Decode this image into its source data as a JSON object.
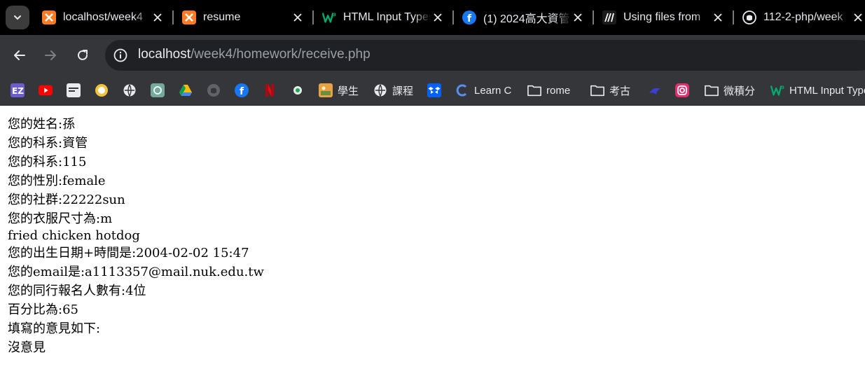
{
  "tabs": [
    {
      "title": "localhost/week4",
      "icon": "xampp-icon",
      "active": false
    },
    {
      "title": "resume",
      "icon": "xampp-icon",
      "active": false
    },
    {
      "title": "HTML Input Types",
      "icon": "w3schools-icon",
      "active": false
    },
    {
      "title": "(1) 2024高大資管",
      "icon": "facebook-icon",
      "active": false
    },
    {
      "title": "Using files from",
      "icon": "mdn-icon",
      "active": false
    },
    {
      "title": "112-2-php/week",
      "icon": "github-icon",
      "active": false
    }
  ],
  "address_bar": {
    "host": "localhost",
    "path": "/week4/homework/receive.php"
  },
  "bookmarks": [
    {
      "label": "",
      "icon": "ez-icon"
    },
    {
      "label": "",
      "icon": "youtube-icon"
    },
    {
      "label": "",
      "icon": "news-icon"
    },
    {
      "label": "",
      "icon": "shell-icon"
    },
    {
      "label": "",
      "icon": "globe-icon"
    },
    {
      "label": "",
      "icon": "chatgpt-icon"
    },
    {
      "label": "",
      "icon": "google-drive-icon"
    },
    {
      "label": "",
      "icon": "github-icon"
    },
    {
      "label": "",
      "icon": "facebook-icon"
    },
    {
      "label": "",
      "icon": "netflix-icon"
    },
    {
      "label": "",
      "icon": "line-icon"
    },
    {
      "label": "學生",
      "icon": "image-icon"
    },
    {
      "label": "課程",
      "icon": "globe-icon"
    },
    {
      "label": "",
      "icon": "dropbox-icon"
    },
    {
      "label": "Learn C",
      "icon": "learn-c-icon"
    },
    {
      "label": "rome",
      "icon": "folder-icon"
    },
    {
      "label": "考古",
      "icon": "folder-icon"
    },
    {
      "label": "",
      "icon": "bird-icon"
    },
    {
      "label": "",
      "icon": "instagram-icon"
    },
    {
      "label": "微積分",
      "icon": "folder-icon"
    },
    {
      "label": "HTML Input Types",
      "icon": "w3schools-icon"
    }
  ],
  "page": {
    "lines": [
      "您的姓名:孫",
      "您的科系:資管",
      "您的科系:115",
      "您的性別:female",
      "您的社群:22222sun",
      "您的衣服尺寸為:m",
      "fried chicken hotdog",
      "您的出生日期+時間是:2004-02-02 15:47",
      "您的email是:a1113357@mail.nuk.edu.tw",
      "您的同行報名人數有:4位",
      "百分比為:65",
      "填寫的意見如下:",
      "沒意見"
    ]
  },
  "colors": {
    "tabstrip_bg": "#000000",
    "toolbar_bg": "#35363a",
    "omnibox_bg": "#202124",
    "text_light": "#e8eaed",
    "text_muted": "#9aa0a6"
  }
}
